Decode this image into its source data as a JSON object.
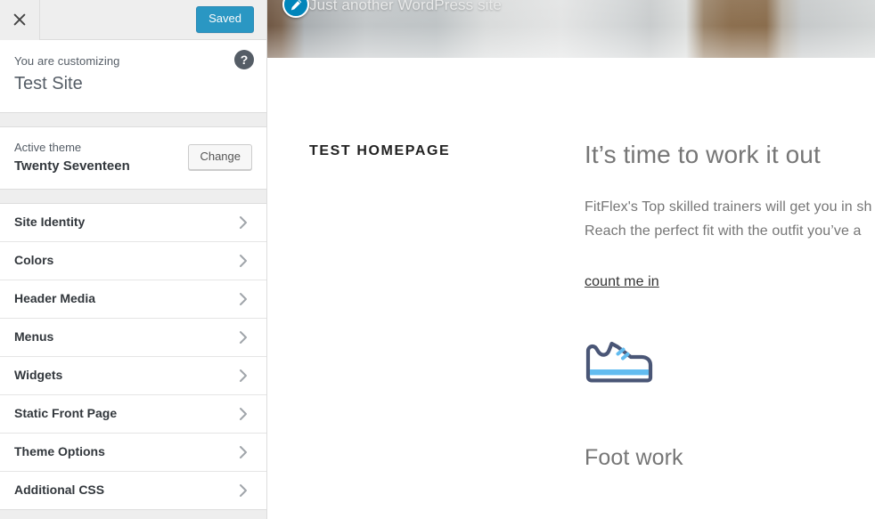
{
  "customizer": {
    "header": {
      "close_icon": "close-icon",
      "save_label": "Saved"
    },
    "info": {
      "label": "You are customizing",
      "site_title": "Test Site",
      "help_icon": "help-icon",
      "help_glyph": "?"
    },
    "theme": {
      "label": "Active theme",
      "name": "Twenty Seventeen",
      "change_label": "Change"
    },
    "panels": [
      {
        "label": "Site Identity"
      },
      {
        "label": "Colors"
      },
      {
        "label": "Header Media"
      },
      {
        "label": "Menus"
      },
      {
        "label": "Widgets"
      },
      {
        "label": "Static Front Page"
      },
      {
        "label": "Theme Options"
      },
      {
        "label": "Additional CSS"
      }
    ]
  },
  "preview": {
    "site_description": "Just another WordPress site",
    "edit_shortcut_icon": "pencil-edit-icon",
    "page_title": "TEST HOMEPAGE",
    "heading": "It’s time to work it out",
    "paragraph_line_1": "FitFlex's Top skilled trainers will get you in sh",
    "paragraph_line_2": "Reach the perfect fit with the outfit you’ve a",
    "cta_link": "count me in",
    "shoe_icon": "sneaker-icon",
    "section_heading": "Foot work"
  },
  "colors": {
    "wp_blue": "#0085ba",
    "sidebar_bg": "#eeeeee",
    "panel_bg": "#ffffff",
    "text_dark": "#32373c",
    "text_muted": "#555d66",
    "preview_text": "#767676",
    "shoe_outline": "#4a5676",
    "shoe_accent": "#62bcf0"
  }
}
